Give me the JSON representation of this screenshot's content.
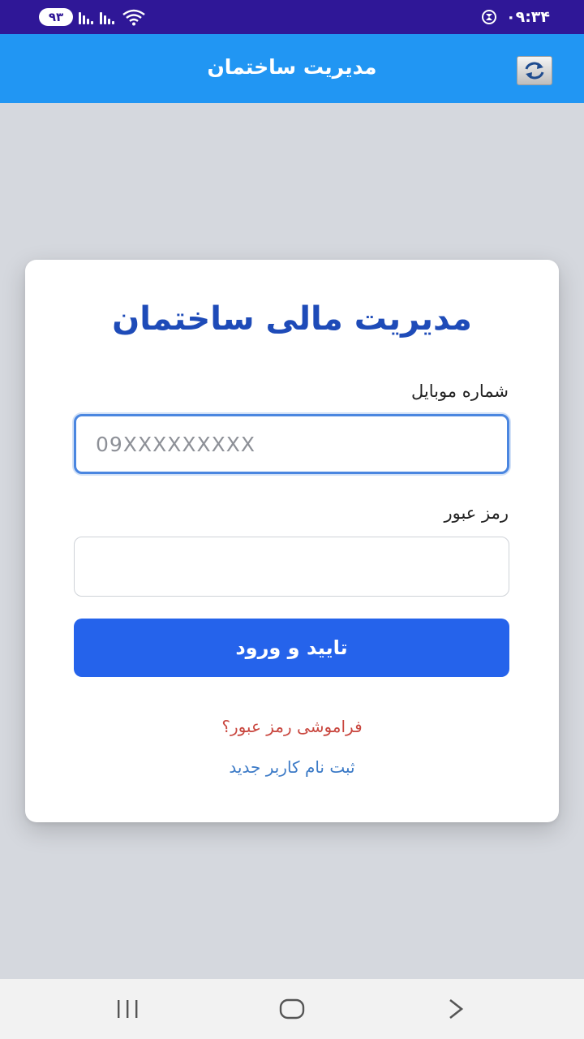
{
  "status_bar": {
    "battery": "۹۳",
    "time": "۰۹:۳۴"
  },
  "app_bar": {
    "title": "مدیریت ساختمان",
    "refresh_icon": "refresh-icon"
  },
  "login_card": {
    "title": "مدیریت مالی ساختمان",
    "mobile_label": "شماره موبایل",
    "mobile_placeholder": "09XXXXXXXXX",
    "mobile_value": "",
    "password_label": "رمز عبور",
    "password_value": "",
    "submit_label": "تایید و ورود",
    "forgot_password_link": "فراموشی رمز عبور؟",
    "register_link": "ثبت نام کاربر جدید"
  },
  "nav_bar": {
    "icons": [
      "recent-apps-icon",
      "home-icon",
      "back-icon"
    ]
  },
  "colors": {
    "status_bar": "#2f1797",
    "app_bar": "#2196f3",
    "title": "#1e4bb8",
    "button": "#2563eb",
    "forgot_link": "#c9473f",
    "register_link": "#3d7bc7"
  }
}
